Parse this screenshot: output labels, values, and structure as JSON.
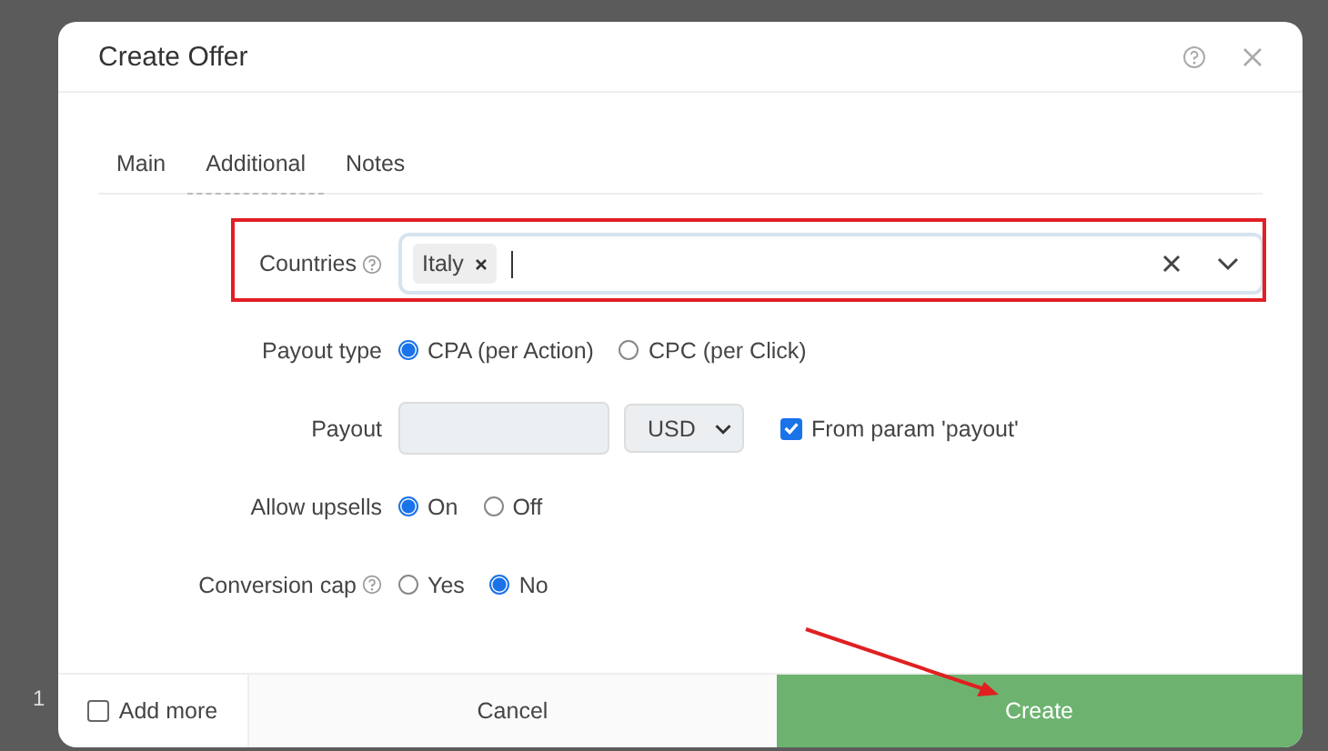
{
  "background": {
    "fragment": "1"
  },
  "dialog": {
    "title": "Create Offer",
    "tabs": [
      {
        "label": "Main",
        "selected": false
      },
      {
        "label": "Additional",
        "selected": true
      },
      {
        "label": "Notes",
        "selected": false
      }
    ],
    "rows": [
      {
        "kind": "tags",
        "label": "Countries",
        "help": true,
        "tags": [
          "Italy"
        ]
      },
      {
        "kind": "radio",
        "label": "Payout type",
        "help": false,
        "options": [
          {
            "label": "CPA (per Action)",
            "selected": true
          },
          {
            "label": "CPC (per Click)",
            "selected": false
          }
        ]
      },
      {
        "kind": "payout",
        "label": "Payout",
        "help": false,
        "currency": "USD",
        "checkbox": {
          "label": "From param 'payout'",
          "checked": true
        }
      },
      {
        "kind": "radio",
        "label": "Allow upsells",
        "help": false,
        "options": [
          {
            "label": "On",
            "selected": true
          },
          {
            "label": "Off",
            "selected": false
          }
        ]
      },
      {
        "kind": "radio",
        "label": "Conversion cap",
        "help": true,
        "options": [
          {
            "label": "Yes",
            "selected": false
          },
          {
            "label": "No",
            "selected": true
          }
        ]
      }
    ],
    "footer": {
      "add_more": {
        "label": "Add more",
        "checked": false
      },
      "cancel": "Cancel",
      "create": "Create"
    }
  }
}
